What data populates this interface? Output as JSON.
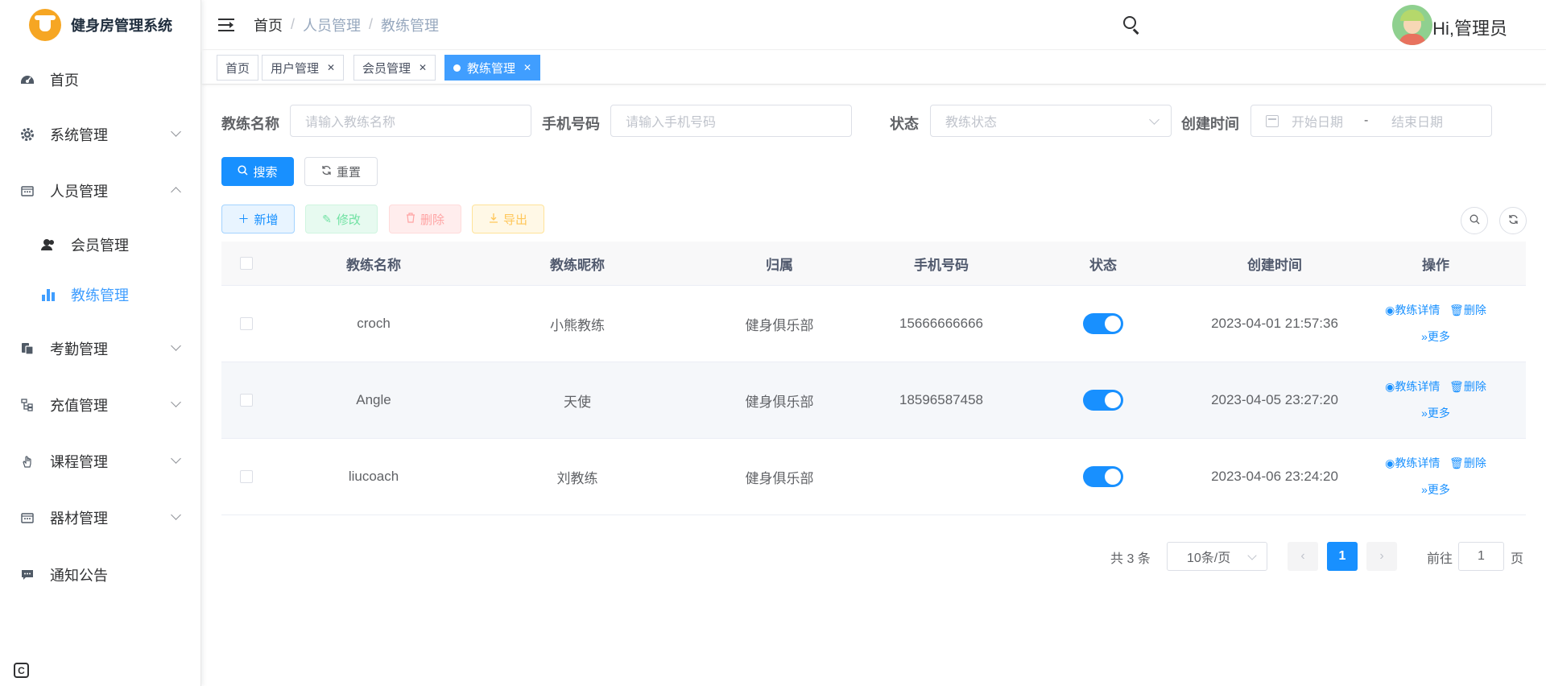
{
  "app": {
    "title": "健身房管理系统"
  },
  "sidebar": {
    "items": [
      {
        "label": "首页",
        "icon": "dashboard-icon"
      },
      {
        "label": "系统管理",
        "icon": "gear-icon"
      },
      {
        "label": "人员管理",
        "icon": "calendar-icon"
      },
      {
        "label": "考勤管理",
        "icon": "clipboard-icon"
      },
      {
        "label": "充值管理",
        "icon": "tree-icon"
      },
      {
        "label": "课程管理",
        "icon": "hand-icon"
      },
      {
        "label": "器材管理",
        "icon": "calendar-icon"
      },
      {
        "label": "通知公告",
        "icon": "message-icon"
      }
    ],
    "sub_items": [
      {
        "label": "会员管理",
        "icon": "user-icon"
      },
      {
        "label": "教练管理",
        "icon": "chart-icon"
      }
    ]
  },
  "header": {
    "breadcrumb": [
      "首页",
      "人员管理",
      "教练管理"
    ],
    "greeting": "Hi,管理员"
  },
  "tags": [
    {
      "label": "首页"
    },
    {
      "label": "用户管理"
    },
    {
      "label": "会员管理"
    },
    {
      "label": "教练管理"
    }
  ],
  "search": {
    "name_label": "教练名称",
    "name_placeholder": "请输入教练名称",
    "phone_label": "手机号码",
    "phone_placeholder": "请输入手机号码",
    "status_label": "状态",
    "status_placeholder": "教练状态",
    "time_label": "创建时间",
    "start_placeholder": "开始日期",
    "range_sep": "-",
    "end_placeholder": "结束日期",
    "search_btn": "搜索",
    "reset_btn": "重置"
  },
  "toolbar": {
    "add": "新增",
    "edit": "修改",
    "delete": "删除",
    "export": "导出"
  },
  "table": {
    "columns": [
      "教练名称",
      "教练昵称",
      "归属",
      "手机号码",
      "状态",
      "创建时间",
      "操作"
    ],
    "rows": [
      {
        "name": "croch",
        "nickname": "小熊教练",
        "belong": "健身俱乐部",
        "phone": "15666666666",
        "status": true,
        "created": "2023-04-01 21:57:36"
      },
      {
        "name": "Angle",
        "nickname": "天使",
        "belong": "健身俱乐部",
        "phone": "18596587458",
        "status": true,
        "created": "2023-04-05 23:27:20"
      },
      {
        "name": "liucoach",
        "nickname": "刘教练",
        "belong": "健身俱乐部",
        "phone": "",
        "status": true,
        "created": "2023-04-06 23:24:20"
      }
    ],
    "ops": {
      "detail": "教练详情",
      "delete": "删除",
      "more": "更多"
    }
  },
  "pagination": {
    "total": "共 3 条",
    "page_size": "10条/页",
    "current": "1",
    "goto_prefix": "前往",
    "goto_value": "1",
    "goto_suffix": "页"
  },
  "colors": {
    "primary": "#1890ff",
    "active_menu": "#409eff"
  }
}
